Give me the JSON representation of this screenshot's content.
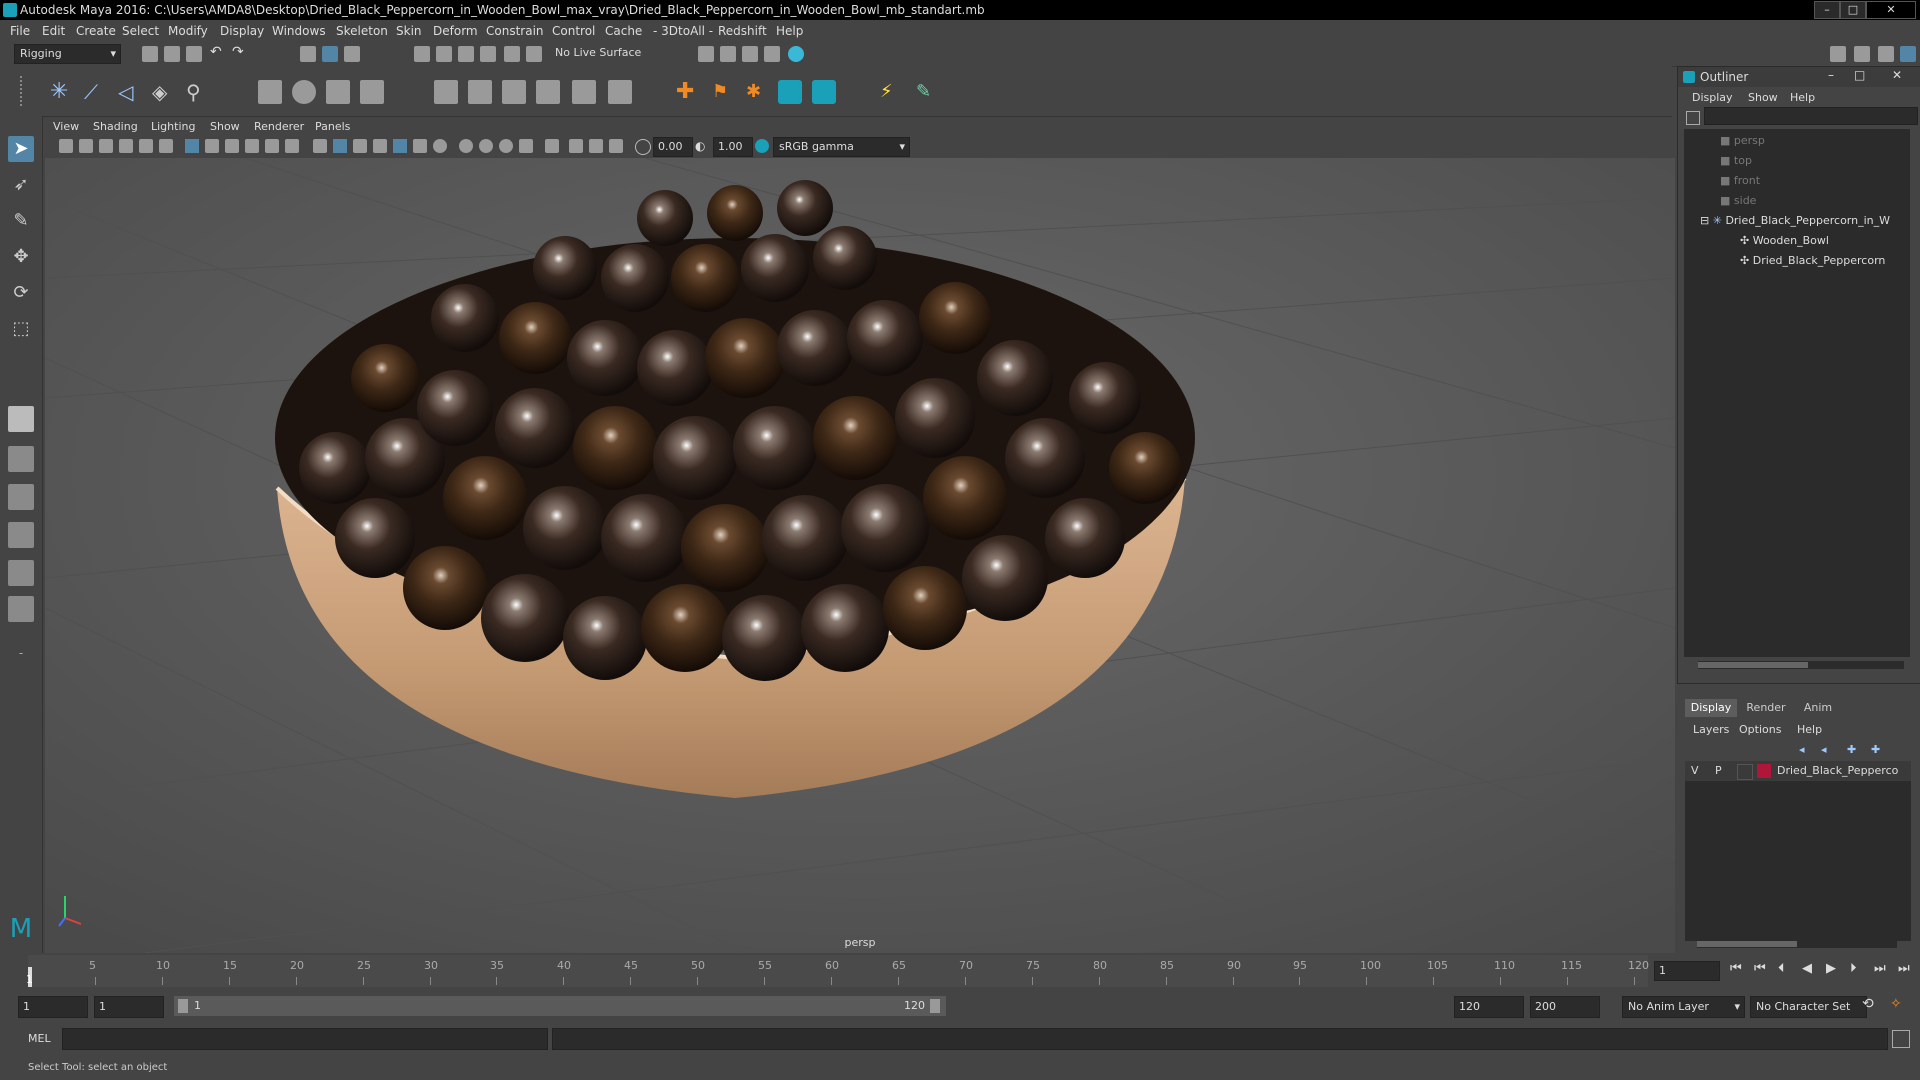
{
  "window": {
    "title": "Autodesk Maya 2016: C:\\Users\\AMDA8\\Desktop\\Dried_Black_Peppercorn_in_Wooden_Bowl_max_vray\\Dried_Black_Peppercorn_in_Wooden_Bowl_mb_standart.mb",
    "min": "–",
    "max": "□",
    "close": "✕"
  },
  "menubar": [
    "File",
    "Edit",
    "Create",
    "Select",
    "Modify",
    "Display",
    "Windows",
    "Skeleton",
    "Skin",
    "Deform",
    "Constrain",
    "Control",
    "Cache",
    "- 3DtoAll -",
    "Redshift",
    "Help"
  ],
  "statusline": {
    "mode": "Rigging",
    "live_surface": "No Live Surface"
  },
  "viewport": {
    "menu": [
      "View",
      "Shading",
      "Lighting",
      "Show",
      "Renderer",
      "Panels"
    ],
    "exposure": "0.00",
    "gamma": "1.00",
    "color_space": "sRGB gamma",
    "camera_label": "persp"
  },
  "outliner": {
    "title": "Outliner",
    "menu": [
      "Display",
      "Show",
      "Help"
    ],
    "items": [
      {
        "label": "persp",
        "kind": "camera"
      },
      {
        "label": "top",
        "kind": "camera"
      },
      {
        "label": "front",
        "kind": "camera"
      },
      {
        "label": "side",
        "kind": "camera"
      },
      {
        "label": "Dried_Black_Peppercorn_in_W",
        "kind": "group"
      },
      {
        "label": "Wooden_Bowl",
        "kind": "mesh"
      },
      {
        "label": "Dried_Black_Peppercorn",
        "kind": "mesh"
      }
    ]
  },
  "layer_editor": {
    "tabs": [
      "Display",
      "Render",
      "Anim"
    ],
    "menu": [
      "Layers",
      "Options",
      "Help"
    ],
    "layer": {
      "v": "V",
      "p": "P",
      "name": "Dried_Black_Pepperco",
      "color": "#b0163a"
    }
  },
  "timeslider": {
    "ticks": [
      "5",
      "10",
      "15",
      "20",
      "25",
      "30",
      "35",
      "40",
      "45",
      "50",
      "55",
      "60",
      "65",
      "70",
      "75",
      "80",
      "85",
      "90",
      "95",
      "100",
      "105",
      "110",
      "115",
      "120"
    ],
    "start_label": "1",
    "current_frame": "1"
  },
  "rangeslider": {
    "start": "1",
    "playback_start": "1",
    "range_start_label": "1",
    "range_end_label": "120",
    "playback_end": "120",
    "end": "200",
    "anim_layer": "No Anim Layer",
    "character_set": "No Character Set"
  },
  "cmdline": {
    "label": "MEL"
  },
  "helpline": {
    "text": "Select Tool: select an object"
  },
  "colors": {
    "accent": "#5285a6",
    "maya_teal": "#1aa0b8",
    "bowl": "#c9a27e"
  }
}
